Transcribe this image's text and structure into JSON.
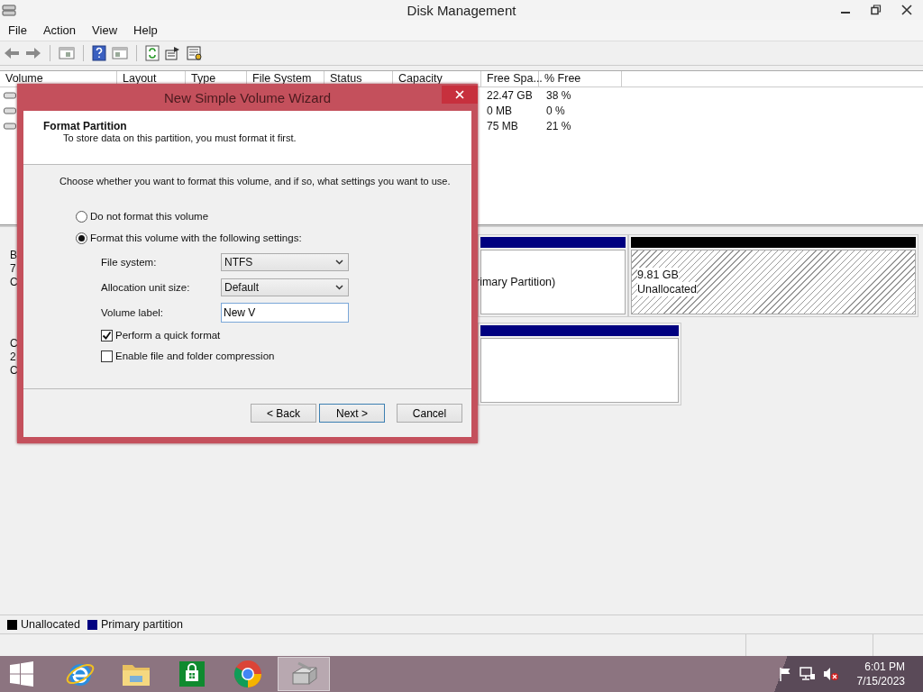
{
  "window": {
    "title": "Disk Management"
  },
  "menu": [
    "File",
    "Action",
    "View",
    "Help"
  ],
  "volume_table": {
    "columns": [
      "Volume",
      "Layout",
      "Type",
      "File System",
      "Status",
      "Capacity",
      "Free Spa...",
      "% Free"
    ],
    "rows": [
      {
        "free_space": "22.47 GB",
        "percent_free": "38 %"
      },
      {
        "free_space": "0 MB",
        "percent_free": "0 %"
      },
      {
        "free_space": "75 MB",
        "percent_free": "21 %"
      }
    ]
  },
  "disks": [
    {
      "label_fragments": [
        "B",
        "7",
        "C"
      ],
      "partitions": [
        {
          "kind": "primary",
          "text": "rimary Partition)"
        },
        {
          "kind": "unallocated",
          "size": "9.81 GB",
          "status": "Unallocated"
        }
      ]
    },
    {
      "label_fragments": [
        "C",
        "2",
        "C"
      ],
      "partitions": [
        {
          "kind": "primary"
        }
      ]
    }
  ],
  "legend": [
    {
      "label": "Unallocated",
      "color": "#000000"
    },
    {
      "label": "Primary partition",
      "color": "#000080"
    }
  ],
  "dialog": {
    "title": "New Simple Volume Wizard",
    "heading": "Format Partition",
    "subheading": "To store data on this partition, you must format it first.",
    "instruction": "Choose whether you want to format this volume, and if so, what settings you want to use.",
    "options": [
      {
        "label": "Do not format this volume",
        "selected": false
      },
      {
        "label": "Format this volume with the following settings:",
        "selected": true
      }
    ],
    "fields": [
      {
        "kind": "dropdown",
        "label": "File system:",
        "value": "NTFS"
      },
      {
        "kind": "dropdown",
        "label": "Allocation unit size:",
        "value": "Default"
      },
      {
        "kind": "text",
        "label": "Volume label:",
        "value": "New V"
      }
    ],
    "checkboxes": [
      {
        "label": "Perform a quick format",
        "checked": true
      },
      {
        "label": "Enable file and folder compression",
        "checked": false
      }
    ],
    "buttons": [
      {
        "label": "< Back",
        "default": false
      },
      {
        "label": "Next >",
        "default": true
      },
      {
        "label": "Cancel",
        "default": false
      }
    ]
  },
  "taskbar": {
    "apps": [
      {
        "kind": "ie",
        "selected": false
      },
      {
        "kind": "explorer",
        "selected": false
      },
      {
        "kind": "store",
        "selected": false
      },
      {
        "kind": "chrome",
        "selected": false
      },
      {
        "kind": "diskmgmt",
        "selected": true
      }
    ],
    "time": "6:01 PM",
    "date": "7/15/2023"
  }
}
